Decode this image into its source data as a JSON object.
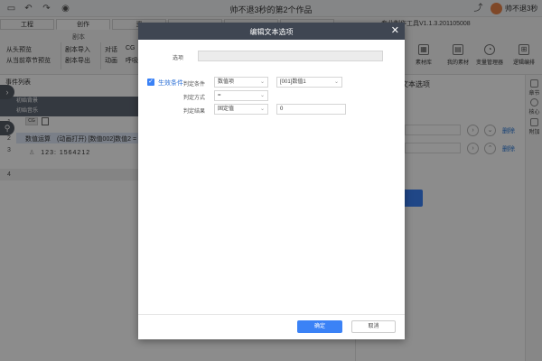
{
  "window": {
    "title": "帅不退3秒的第2个作品",
    "user": "帅不退3秒",
    "version": "专业制作工具V1.1.3.201105008"
  },
  "ribbon": {
    "tabs": [
      "工程",
      "创作",
      "资",
      "",
      "",
      ""
    ],
    "group_label": "剧本",
    "buttons": [
      "从头预览",
      "从当前章节预览",
      "剧本导入",
      "剧本导出",
      "对话",
      "动画",
      "CG",
      "呼吸"
    ],
    "icon_buttons": [
      "素材库",
      "我的素材",
      "变量管理器",
      "逻辑编排"
    ]
  },
  "left": {
    "header": "事件列表",
    "events": [
      "初始背景",
      "初始音乐"
    ],
    "row_numbers": [
      "1",
      "2",
      "3",
      "4"
    ],
    "cg_tag": "CG",
    "selected_row": {
      "type": "数值运算",
      "desc": "(动画打开) [数值002]数值2 ="
    },
    "speaker_line": "123: 1564212"
  },
  "right_panel": {
    "title": "编辑文本选项",
    "delete_label": "删除"
  },
  "vtool": [
    "章节",
    "核心",
    "附加"
  ],
  "modal": {
    "title": "编辑文本选项",
    "option_label": "选项",
    "condition_checkbox": "生效条件",
    "condition_label": "判定条件",
    "condition_type": "数值项",
    "condition_value": "[001]数值1",
    "method_label": "判定方式",
    "method_value": "=",
    "result_label": "判定结果",
    "result_type": "固定值",
    "result_value": "0",
    "ok": "确定",
    "cancel": "取消"
  },
  "colors": {
    "accent": "#3b82f6",
    "modal_header": "#3f4652",
    "event_row": "#5f6876"
  }
}
